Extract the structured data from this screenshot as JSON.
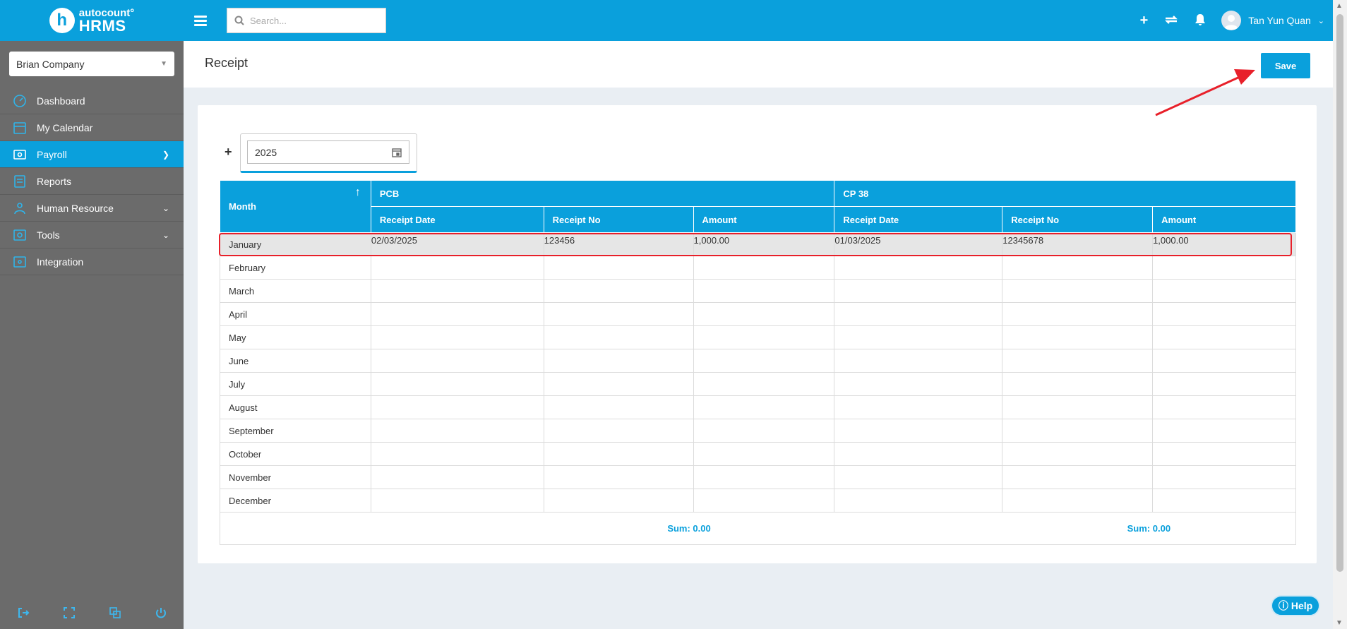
{
  "app": {
    "logo_badge": "h",
    "logo_sub": "autocount°",
    "logo_main": "HRMS"
  },
  "company_selector": {
    "value": "Brian Company"
  },
  "sidebar": {
    "items": [
      {
        "label": "Dashboard",
        "icon": "gauge-icon"
      },
      {
        "label": "My Calendar",
        "icon": "calendar-icon"
      },
      {
        "label": "Payroll",
        "icon": "payroll-icon",
        "active": true
      },
      {
        "label": "Reports",
        "icon": "reports-icon"
      },
      {
        "label": "Human Resource",
        "icon": "human-resource-icon"
      },
      {
        "label": "Tools",
        "icon": "tools-icon"
      },
      {
        "label": "Integration",
        "icon": "integration-icon"
      }
    ]
  },
  "topbar": {
    "search_placeholder": "Search...",
    "user_name": "Tan Yun Quan"
  },
  "page": {
    "title": "Receipt",
    "save_label": "Save"
  },
  "year_picker": {
    "value": "2025"
  },
  "table": {
    "month_header": "Month",
    "group_pcb": "PCB",
    "group_cp38": "CP 38",
    "sub_headers": [
      "Receipt Date",
      "Receipt No",
      "Amount",
      "Receipt Date",
      "Receipt No",
      "Amount"
    ],
    "rows": [
      {
        "month": "January",
        "pcb_date": "02/03/2025",
        "pcb_no": "123456",
        "pcb_amount": "1,000.00",
        "cp_date": "01/03/2025",
        "cp_no": "12345678",
        "cp_amount": "1,000.00"
      },
      {
        "month": "February"
      },
      {
        "month": "March"
      },
      {
        "month": "April"
      },
      {
        "month": "May"
      },
      {
        "month": "June"
      },
      {
        "month": "July"
      },
      {
        "month": "August"
      },
      {
        "month": "September"
      },
      {
        "month": "October"
      },
      {
        "month": "November"
      },
      {
        "month": "December"
      }
    ],
    "sum_pcb": "Sum: 0.00",
    "sum_cp38": "Sum: 0.00"
  },
  "help": {
    "label": "Help"
  },
  "colors": {
    "accent": "#0aa0dc",
    "sidebar_bg": "#6b6b6b",
    "annotation": "#e8202a"
  }
}
